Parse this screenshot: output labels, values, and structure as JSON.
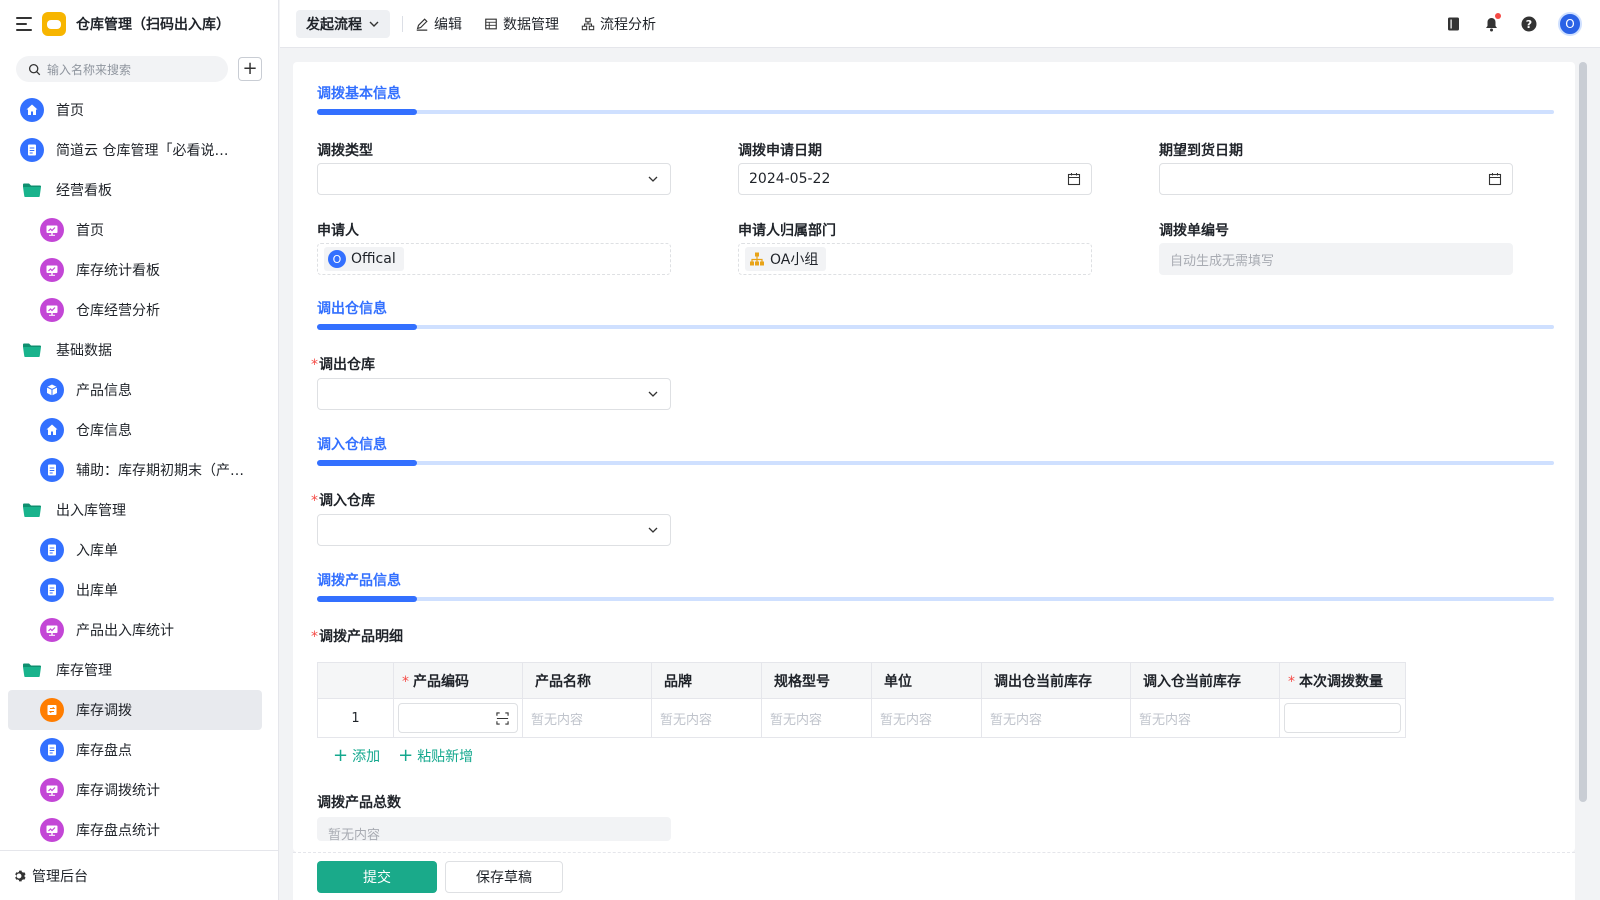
{
  "app": {
    "title": "仓库管理（扫码出入库）",
    "search_placeholder": "输入名称来搜索",
    "admin_label": "管理后台"
  },
  "sidebar": {
    "items": [
      {
        "label": "首页",
        "icon": "home-icon",
        "level": 0,
        "type": "page",
        "color": "#3370ff"
      },
      {
        "label": "简道云 仓库管理「必看说明」",
        "icon": "document-icon",
        "level": 0,
        "type": "page",
        "color": "#3370ff"
      },
      {
        "label": "经营看板",
        "icon": "folder-icon",
        "level": 0,
        "type": "folder"
      },
      {
        "label": "首页",
        "icon": "dashboard-icon",
        "level": 1,
        "type": "page",
        "color": "#c346d6"
      },
      {
        "label": "库存统计看板",
        "icon": "dashboard-icon",
        "level": 1,
        "type": "page",
        "color": "#c346d6"
      },
      {
        "label": "仓库经营分析",
        "icon": "dashboard-icon",
        "level": 1,
        "type": "page",
        "color": "#c346d6"
      },
      {
        "label": "基础数据",
        "icon": "folder-icon",
        "level": 0,
        "type": "folder"
      },
      {
        "label": "产品信息",
        "icon": "box-icon",
        "level": 1,
        "type": "page",
        "color": "#3370ff"
      },
      {
        "label": "仓库信息",
        "icon": "home-icon",
        "level": 1,
        "type": "page",
        "color": "#3370ff"
      },
      {
        "label": "辅助：库存期初期末（产…",
        "icon": "document-icon",
        "level": 1,
        "type": "page",
        "color": "#3370ff"
      },
      {
        "label": "出入库管理",
        "icon": "folder-icon",
        "level": 0,
        "type": "folder"
      },
      {
        "label": "入库单",
        "icon": "document-icon",
        "level": 1,
        "type": "page",
        "color": "#3370ff"
      },
      {
        "label": "出库单",
        "icon": "document-icon",
        "level": 1,
        "type": "page",
        "color": "#3370ff"
      },
      {
        "label": "产品出入库统计",
        "icon": "dashboard-icon",
        "level": 1,
        "type": "page",
        "color": "#c346d6"
      },
      {
        "label": "库存管理",
        "icon": "folder-icon",
        "level": 0,
        "type": "folder"
      },
      {
        "label": "库存调拨",
        "icon": "transfer-icon",
        "level": 1,
        "type": "page",
        "color": "#ff7d00",
        "active": true
      },
      {
        "label": "库存盘点",
        "icon": "document-icon",
        "level": 1,
        "type": "page",
        "color": "#3370ff"
      },
      {
        "label": "库存调拨统计",
        "icon": "dashboard-icon",
        "level": 1,
        "type": "page",
        "color": "#c346d6"
      },
      {
        "label": "库存盘点统计",
        "icon": "dashboard-icon",
        "level": 1,
        "type": "page",
        "color": "#c346d6"
      }
    ]
  },
  "toolbar": {
    "flow_label": "发起流程",
    "edit_label": "编辑",
    "data_label": "数据管理",
    "analysis_label": "流程分析"
  },
  "form": {
    "section_basic": "调拨基本信息",
    "section_out": "调出仓信息",
    "section_in": "调入仓信息",
    "section_product": "调拨产品信息",
    "transfer_type": {
      "label": "调拨类型",
      "value": ""
    },
    "apply_date": {
      "label": "调拨申请日期",
      "value": "2024-05-22"
    },
    "expected_date": {
      "label": "期望到货日期",
      "value": ""
    },
    "applicant": {
      "label": "申请人",
      "value": "Offical",
      "avatar": "O"
    },
    "department": {
      "label": "申请人归属部门",
      "value": "OA小组"
    },
    "order_no": {
      "label": "调拨单编号",
      "placeholder": "自动生成无需填写"
    },
    "out_warehouse": {
      "label": "调出仓库",
      "required": "*",
      "value": ""
    },
    "in_warehouse": {
      "label": "调入仓库",
      "required": "*",
      "value": ""
    },
    "detail_label": "调拨产品明细",
    "detail_required": "*",
    "table": {
      "columns": [
        {
          "label": "产品编码",
          "required": "*"
        },
        {
          "label": "产品名称",
          "required": ""
        },
        {
          "label": "品牌",
          "required": ""
        },
        {
          "label": "规格型号",
          "required": ""
        },
        {
          "label": "单位",
          "required": ""
        },
        {
          "label": "调出仓当前库存",
          "required": ""
        },
        {
          "label": "调入仓当前库存",
          "required": ""
        },
        {
          "label": "本次调拨数量",
          "required": "*"
        }
      ],
      "rows": [
        {
          "index": "1",
          "cells": [
            "",
            "暂无内容",
            "暂无内容",
            "暂无内容",
            "暂无内容",
            "暂无内容",
            "暂无内容",
            ""
          ]
        }
      ],
      "add_label": "添加",
      "paste_label": "粘贴新增"
    },
    "total_label": "调拨产品总数",
    "total_placeholder": "暂无内容"
  },
  "footer": {
    "submit_label": "提交",
    "draft_label": "保存草稿"
  },
  "colors": {
    "primary": "#3370ff",
    "submit": "#1aaa8a",
    "accent_green": "#14a88e"
  }
}
